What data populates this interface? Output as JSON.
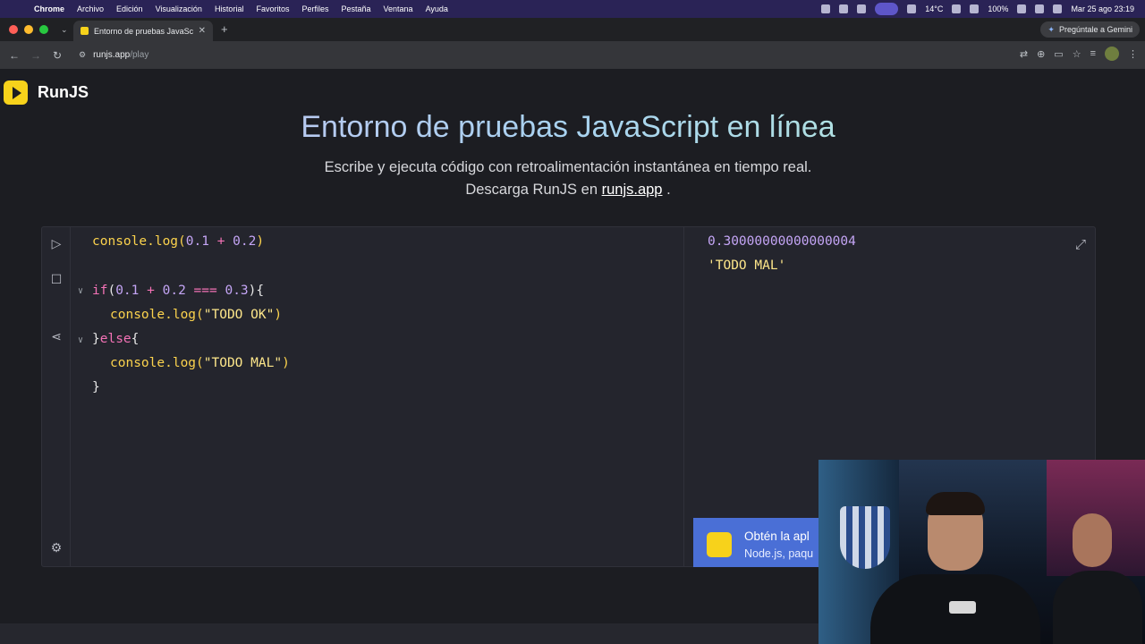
{
  "menubar": {
    "items": [
      "Chrome",
      "Archivo",
      "Edición",
      "Visualización",
      "Historial",
      "Favoritos",
      "Perfiles",
      "Pestaña",
      "Ventana",
      "Ayuda"
    ],
    "temperature": "14°C",
    "battery": "100%",
    "datetime": "Mar 25 ago  23:19"
  },
  "browser": {
    "tab_title": "Entorno de pruebas JavaScript",
    "gemini_label": "Pregúntale a Gemini",
    "url_host": "runjs.app",
    "url_path": "/play"
  },
  "page": {
    "logo_text": "RunJS",
    "title": "Entorno de pruebas JavaScript en línea",
    "subtitle_line1": "Escribe y ejecuta código con retroalimentación instantánea en tiempo real.",
    "subtitle_prefix": "Descarga RunJS en",
    "subtitle_link": "runjs.app",
    "subtitle_suffix": " ."
  },
  "editor": {
    "code": {
      "l1_fn": "console.log(",
      "l1_a": "0.1",
      "l1_op": " + ",
      "l1_b": "0.2",
      "l1_close": ")",
      "l3_kw": "if",
      "l3_open": "(",
      "l3_a": "0.1",
      "l3_op1": " + ",
      "l3_b": "0.2",
      "l3_op2": " === ",
      "l3_c": "0.3",
      "l3_close": "){",
      "l4_fn": "console.log(",
      "l4_str": "\"TODO OK\"",
      "l4_close": ")",
      "l5_open": "}",
      "l5_kw": "else",
      "l5_brace": "{",
      "l6_fn": "console.log(",
      "l6_str": "\"TODO MAL\"",
      "l6_close": ")",
      "l7": "}"
    },
    "output": {
      "line1": "0.30000000000000004",
      "line2": "'TODO MAL'"
    }
  },
  "banner": {
    "title": "Obtén la apl",
    "subtitle": "Node.js, paqu"
  },
  "colors": {
    "accent_yellow": "#f7d21b",
    "banner_blue": "#4a6fd6",
    "editor_bg": "#24252d"
  }
}
